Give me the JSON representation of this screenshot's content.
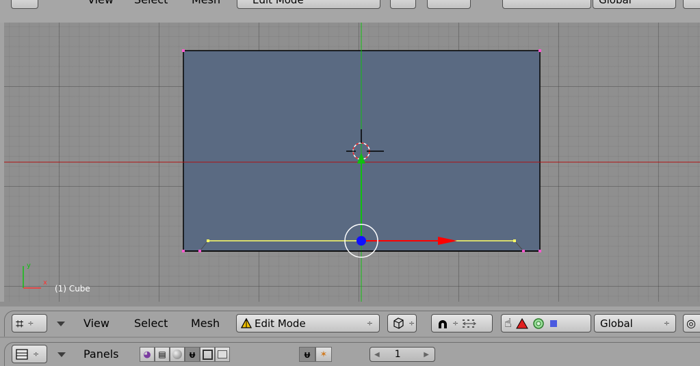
{
  "top_header": {
    "menus": [
      "View",
      "Select",
      "Mesh"
    ],
    "mode": "Edit Mode",
    "orientation": "Global"
  },
  "viewport": {
    "object_info": "(1) Cube",
    "axis_y": "y",
    "axis_x": "x"
  },
  "view_header": {
    "menus": [
      "View",
      "Select",
      "Mesh"
    ],
    "mode": "Edit Mode",
    "orientation": "Global",
    "updown": "÷"
  },
  "buttons_header": {
    "panels_label": "Panels",
    "frame": "1"
  },
  "colors": {
    "header_bg": "#a3a3a3",
    "viewport_bg": "#8f8f8f",
    "face_fill": "#5a6a82",
    "edge_selected": "#ffff66",
    "x_axis": "#b01010",
    "y_axis": "#10c010",
    "manipulator_x": "#ff0000",
    "manipulator_center": "#1010ff"
  }
}
